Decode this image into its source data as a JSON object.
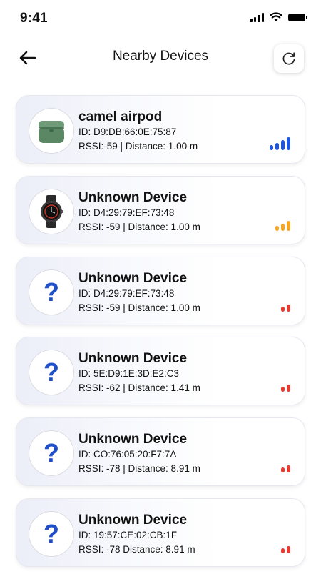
{
  "status_bar": {
    "time": "9:41"
  },
  "header": {
    "title": "Nearby Devices"
  },
  "colors": {
    "strong": "#1f56e0",
    "medium": "#f5a623",
    "weak": "#e6392f",
    "inactive": "#d9d9d9"
  },
  "devices": [
    {
      "name": "camel airpod",
      "id": "ID: D9:DB:66:0E:75:87",
      "rssi_line": "RSSI:-59 | Distance: 1.00 m",
      "icon": "airpods-icon",
      "signal_bars": 4,
      "signal_level": "strong"
    },
    {
      "name": "Unknown Device",
      "id": "ID: D4:29:79:EF:73:48",
      "rssi_line": "RSSI: -59 | Distance: 1.00 m",
      "icon": "smartwatch-icon",
      "signal_bars": 3,
      "signal_level": "medium"
    },
    {
      "name": "Unknown Device",
      "id": "ID: D4:29:79:EF:73:48",
      "rssi_line": "RSSI: -59 | Distance: 1.00 m",
      "icon": "question-mark-icon",
      "signal_bars": 2,
      "signal_level": "weak"
    },
    {
      "name": "Unknown Device",
      "id": "ID: 5E:D9:1E:3D:E2:C3",
      "rssi_line": "RSSI: -62 | Distance: 1.41 m",
      "icon": "question-mark-icon",
      "signal_bars": 2,
      "signal_level": "weak"
    },
    {
      "name": "Unknown Device",
      "id": "ID: CO:76:05:20:F7:7A",
      "rssi_line": "RSSI: -78 | Distance: 8.91 m",
      "icon": "question-mark-icon",
      "signal_bars": 2,
      "signal_level": "weak"
    },
    {
      "name": "Unknown Device",
      "id": "ID: 19:57:CE:02:CB:1F",
      "rssi_line": "RSSI: -78 Distance: 8.91 m",
      "icon": "question-mark-icon",
      "signal_bars": 2,
      "signal_level": "weak"
    }
  ]
}
